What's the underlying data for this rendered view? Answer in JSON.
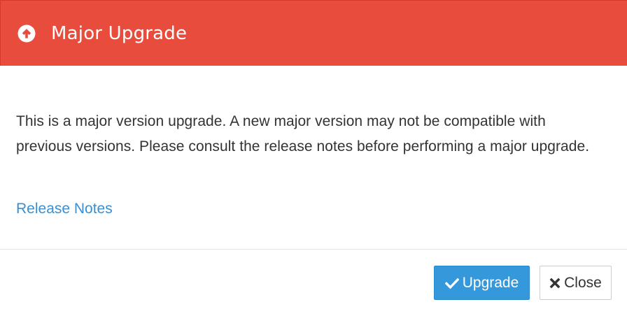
{
  "dialog": {
    "title": "Major Upgrade",
    "header_icon": "arrow-circle-up-icon",
    "header_color": "#e74c3c",
    "message": "This is a major version upgrade. A new major version may not be compatible with previous versions. Please consult the release notes before performing a major upgrade.",
    "link_label": "Release Notes",
    "link_color": "#3b8fd0"
  },
  "footer": {
    "upgrade_label": "Upgrade",
    "upgrade_icon": "check-icon",
    "upgrade_color": "#3498db",
    "close_label": "Close",
    "close_icon": "times-icon"
  }
}
